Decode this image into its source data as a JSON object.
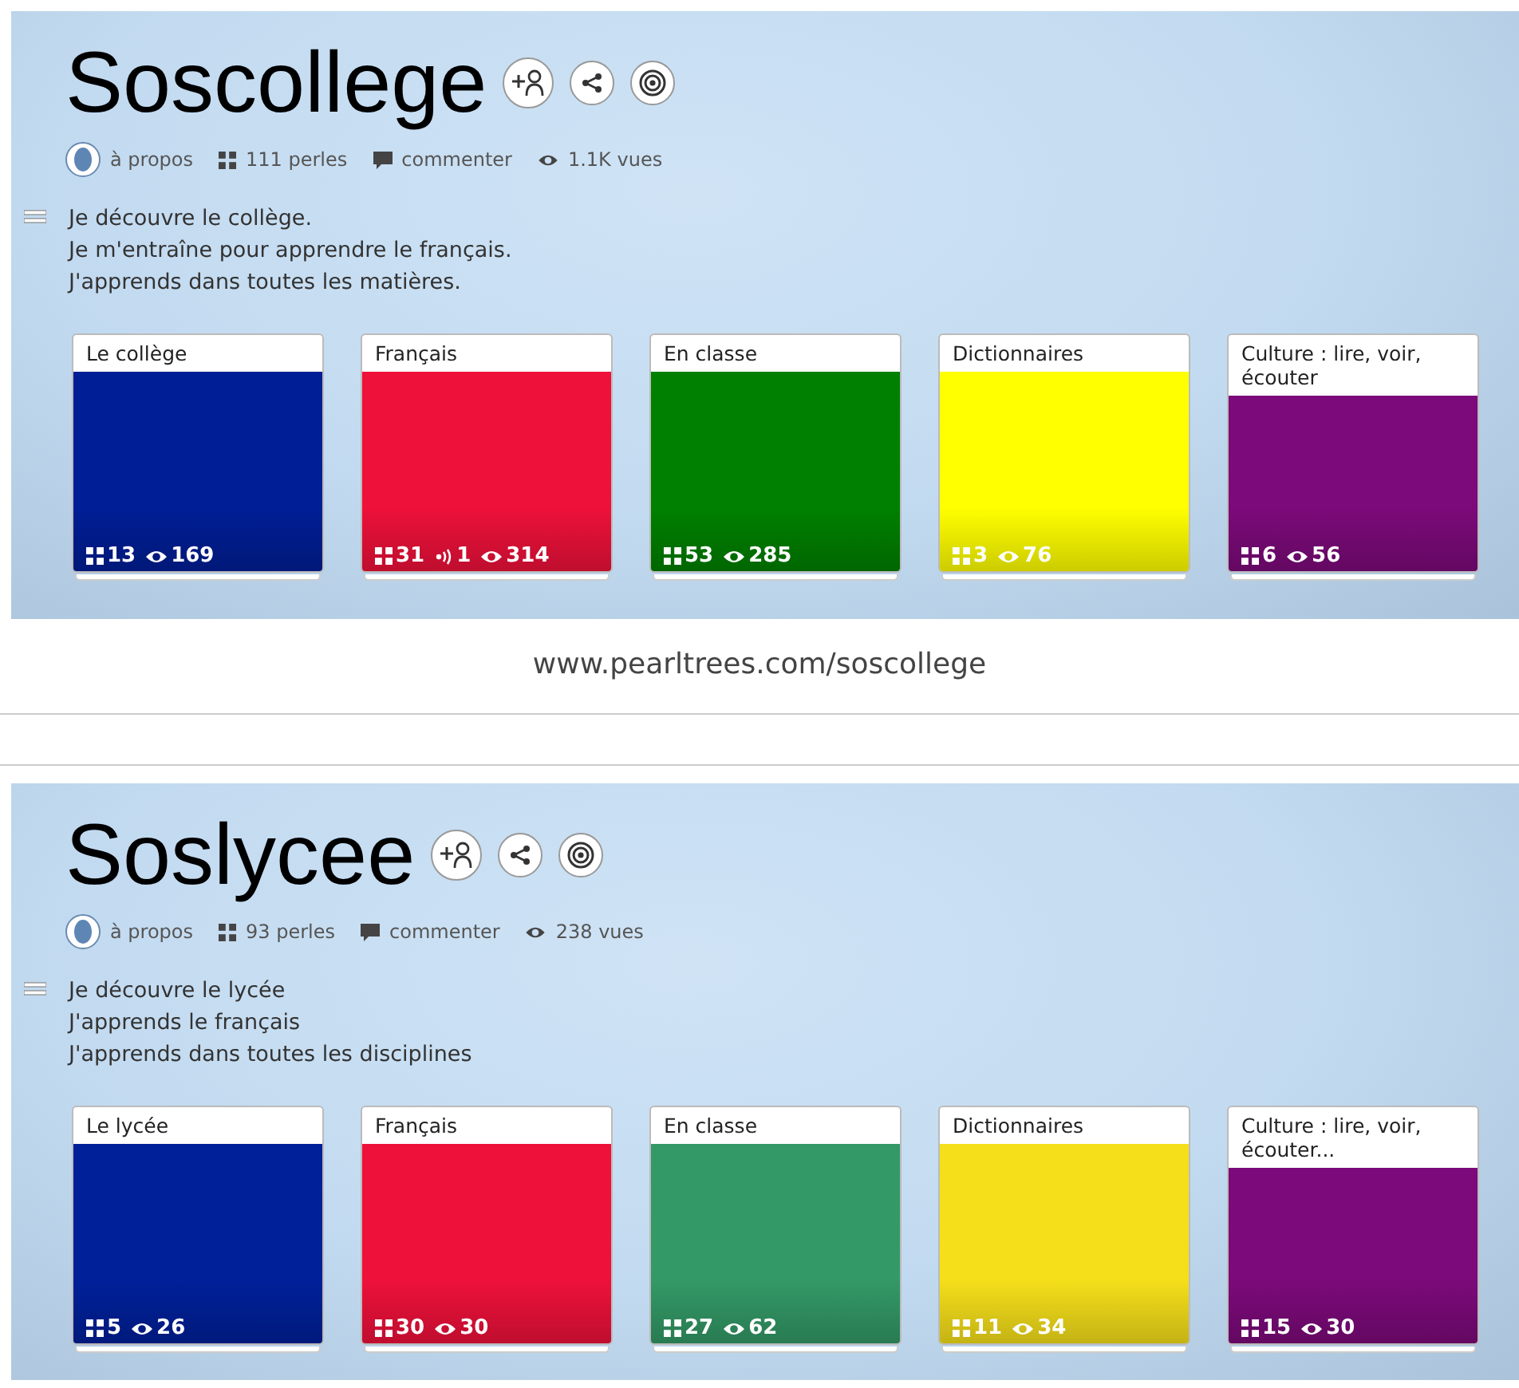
{
  "collections": [
    {
      "title": "Soscollege",
      "meta": {
        "about": "à propos",
        "pearls": "111 perles",
        "comment": "commenter",
        "views": "1.1K vues"
      },
      "description": [
        "Je découvre le collège.",
        "Je m'entraîne pour apprendre le français.",
        "J'apprends dans toutes les matières."
      ],
      "cards": [
        {
          "title": "Le collège",
          "color": "#001e96",
          "stats": [
            {
              "kind": "pearls",
              "value": "13"
            },
            {
              "kind": "views",
              "value": "169"
            }
          ]
        },
        {
          "title": "Français",
          "color": "#ee113a",
          "stats": [
            {
              "kind": "pearls",
              "value": "31"
            },
            {
              "kind": "audio",
              "value": "1"
            },
            {
              "kind": "views",
              "value": "314"
            }
          ]
        },
        {
          "title": "En classe",
          "color": "#008000",
          "stats": [
            {
              "kind": "pearls",
              "value": "53"
            },
            {
              "kind": "views",
              "value": "285"
            }
          ]
        },
        {
          "title": "Dictionnaires",
          "color": "#ffff00",
          "stats": [
            {
              "kind": "pearls",
              "value": "3"
            },
            {
              "kind": "views",
              "value": "76"
            }
          ]
        },
        {
          "title": "Culture : lire, voir, écouter",
          "color": "#7c0a7a",
          "stats": [
            {
              "kind": "pearls",
              "value": "6"
            },
            {
              "kind": "views",
              "value": "56"
            }
          ]
        }
      ]
    },
    {
      "title": "Soslycee",
      "meta": {
        "about": "à propos",
        "pearls": "93 perles",
        "comment": "commenter",
        "views": "238 vues"
      },
      "description": [
        "Je découvre le lycée",
        "J'apprends le français",
        "J'apprends dans toutes les disciplines"
      ],
      "cards": [
        {
          "title": "Le lycée",
          "color": "#00209a",
          "stats": [
            {
              "kind": "pearls",
              "value": "5"
            },
            {
              "kind": "views",
              "value": "26"
            }
          ]
        },
        {
          "title": "Français",
          "color": "#ee113a",
          "stats": [
            {
              "kind": "pearls",
              "value": "30"
            },
            {
              "kind": "views",
              "value": "30"
            }
          ]
        },
        {
          "title": "En classe",
          "color": "#339966",
          "stats": [
            {
              "kind": "pearls",
              "value": "27"
            },
            {
              "kind": "views",
              "value": "62"
            }
          ]
        },
        {
          "title": "Dictionnaires",
          "color": "#f5df1a",
          "stats": [
            {
              "kind": "pearls",
              "value": "11"
            },
            {
              "kind": "views",
              "value": "34"
            }
          ]
        },
        {
          "title": "Culture : lire, voir, écouter...",
          "color": "#7c0a7a",
          "stats": [
            {
              "kind": "pearls",
              "value": "15"
            },
            {
              "kind": "views",
              "value": "30"
            }
          ]
        }
      ]
    }
  ],
  "url": "www.pearltrees.com/soscollege"
}
